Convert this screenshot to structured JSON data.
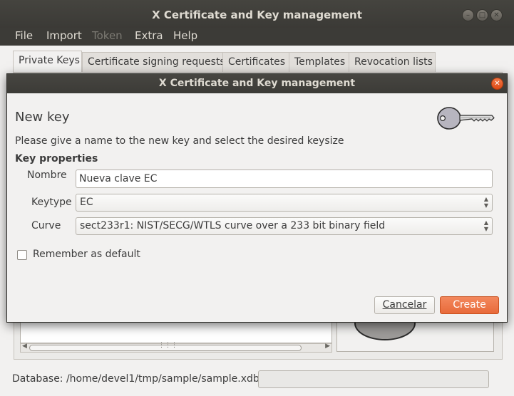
{
  "app": {
    "title": "X Certificate and Key management",
    "menu": [
      {
        "label": "File",
        "enabled": true
      },
      {
        "label": "Import",
        "enabled": true
      },
      {
        "label": "Token",
        "enabled": false
      },
      {
        "label": "Extra",
        "enabled": true
      },
      {
        "label": "Help",
        "enabled": true
      }
    ],
    "tabs": [
      {
        "label": "Private Keys",
        "active": true
      },
      {
        "label": "Certificate signing requests",
        "active": false
      },
      {
        "label": "Certificates",
        "active": false
      },
      {
        "label": "Templates",
        "active": false
      },
      {
        "label": "Revocation lists",
        "active": false
      }
    ],
    "status": "Database: /home/devel1/tmp/sample/sample.xdb"
  },
  "dialog": {
    "title": "X Certificate and Key management",
    "heading": "New key",
    "instructions": "Please give a name to the new key and select the desired keysize",
    "section_title": "Key properties",
    "fields": {
      "name_label": "Nombre",
      "name_value": "Nueva clave EC",
      "keytype_label": "Keytype",
      "keytype_value": "EC",
      "curve_label": "Curve",
      "curve_value": "sect233r1: NIST/SECG/WTLS curve over a 233 bit binary field"
    },
    "remember_label": "Remember as default",
    "remember_checked": false,
    "cancel_label": "Cancelar",
    "create_label": "Create"
  },
  "colors": {
    "accent": "#e86a3a",
    "titlebar": "#3c3b37",
    "window_bg": "#f2f1f0"
  },
  "icons": [
    "close-icon",
    "minimize-icon",
    "maximize-icon",
    "key-icon",
    "chevron-updown-icon"
  ]
}
